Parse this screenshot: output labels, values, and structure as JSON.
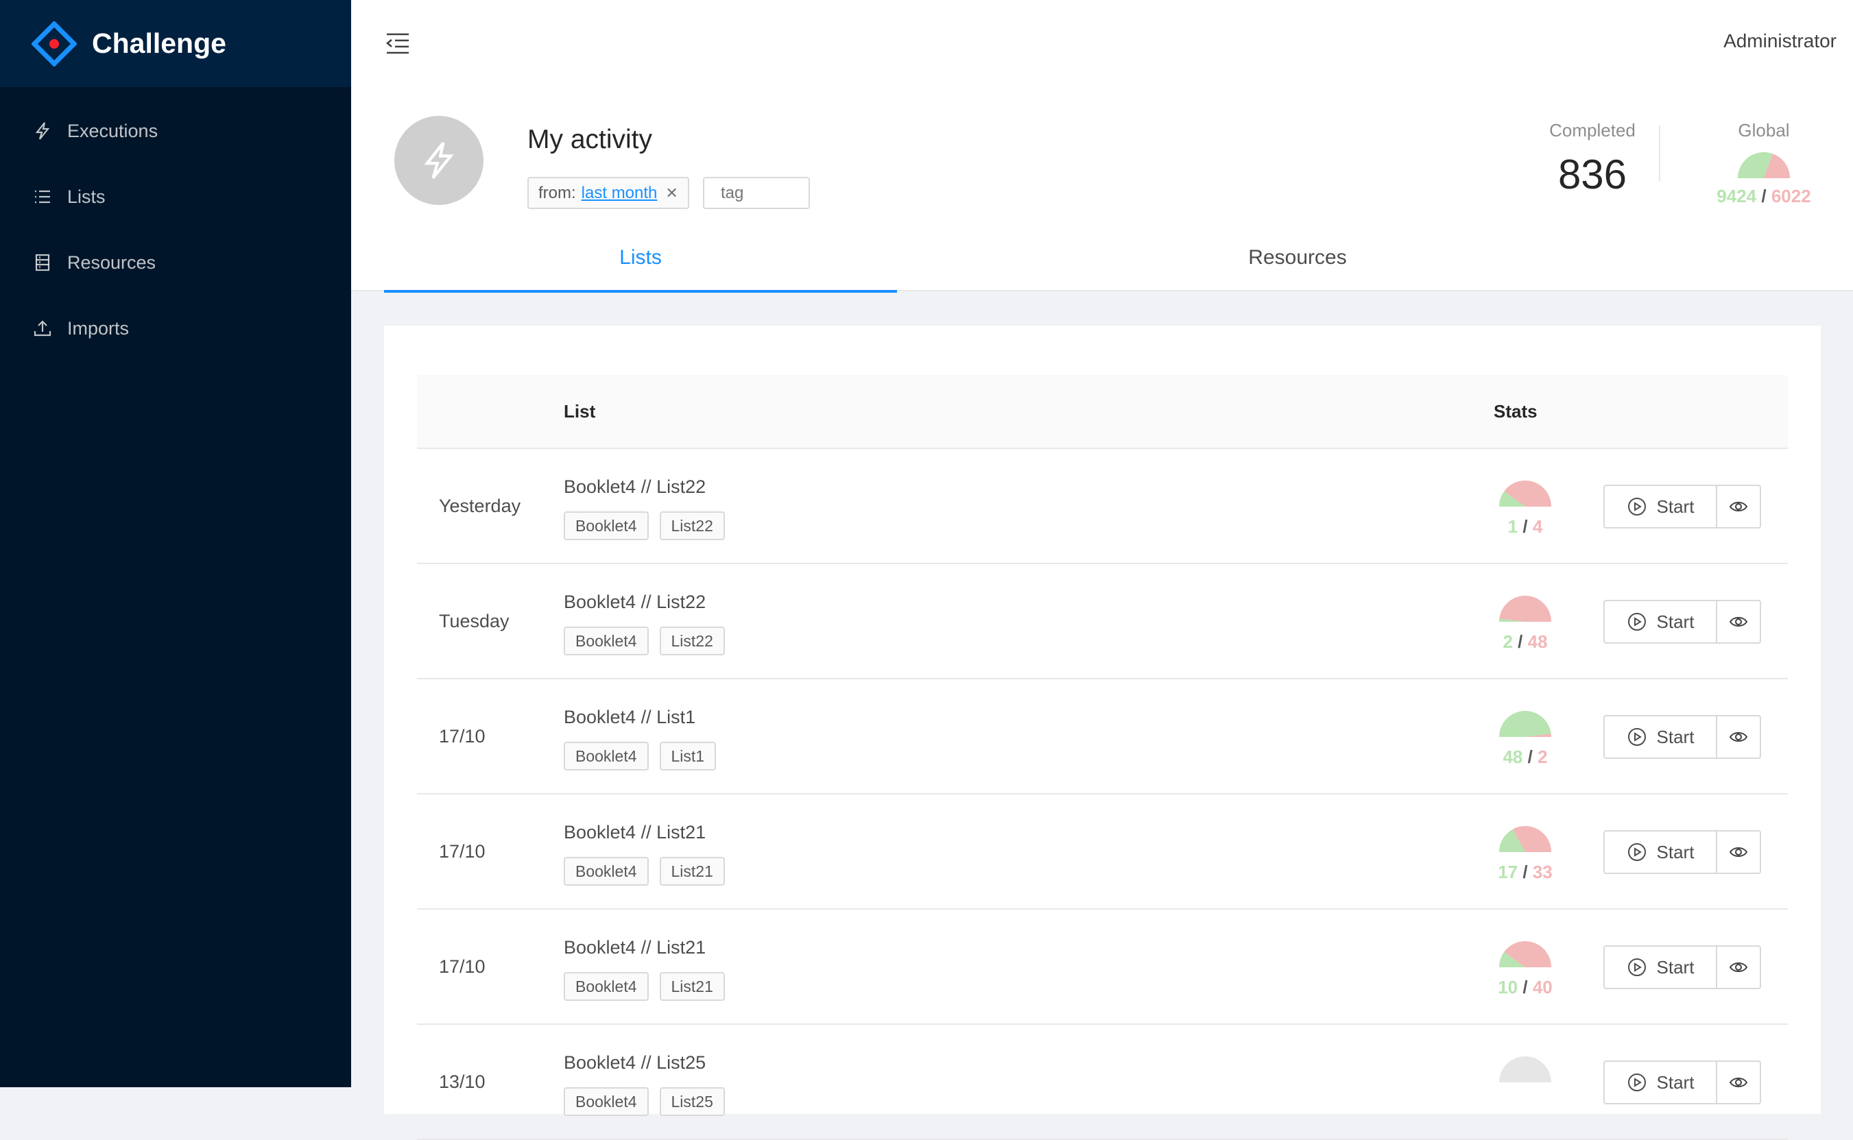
{
  "app": {
    "name": "Challenge",
    "brand_color": "#001529",
    "accent": "#1890ff"
  },
  "sidebar": {
    "items": [
      {
        "label": "Executions",
        "icon": "thunderbolt-icon"
      },
      {
        "label": "Lists",
        "icon": "unordered-list-icon"
      },
      {
        "label": "Resources",
        "icon": "database-icon"
      },
      {
        "label": "Imports",
        "icon": "upload-icon"
      }
    ]
  },
  "header": {
    "user": "Administrator"
  },
  "page": {
    "title": "My activity",
    "filter": {
      "prefix": "from:",
      "value": "last month"
    },
    "tag_placeholder": "tag",
    "completed": {
      "label": "Completed",
      "value": "836"
    },
    "global": {
      "label": "Global",
      "correct": "9424",
      "wrong": "6022"
    },
    "tabs": [
      {
        "label": "Lists",
        "active": true
      },
      {
        "label": "Resources",
        "active": false
      }
    ]
  },
  "table": {
    "columns": {
      "list": "List",
      "stats": "Stats"
    },
    "start_label": "Start",
    "rows": [
      {
        "date": "Yesterday",
        "name": "Booklet4 // List22",
        "tags": [
          "Booklet4",
          "List22"
        ],
        "correct": "1",
        "wrong": "4"
      },
      {
        "date": "Tuesday",
        "name": "Booklet4 // List22",
        "tags": [
          "Booklet4",
          "List22"
        ],
        "correct": "2",
        "wrong": "48"
      },
      {
        "date": "17/10",
        "name": "Booklet4 // List1",
        "tags": [
          "Booklet4",
          "List1"
        ],
        "correct": "48",
        "wrong": "2"
      },
      {
        "date": "17/10",
        "name": "Booklet4 // List21",
        "tags": [
          "Booklet4",
          "List21"
        ],
        "correct": "17",
        "wrong": "33"
      },
      {
        "date": "17/10",
        "name": "Booklet4 // List21",
        "tags": [
          "Booklet4",
          "List21"
        ],
        "correct": "10",
        "wrong": "40"
      },
      {
        "date": "13/10",
        "name": "Booklet4 // List25",
        "tags": [
          "Booklet4",
          "List25"
        ],
        "correct": "",
        "wrong": ""
      }
    ]
  },
  "gauge_colors": {
    "correct": "#b7e4b0",
    "wrong": "#f2b7b7",
    "empty": "#e6e6e6"
  }
}
